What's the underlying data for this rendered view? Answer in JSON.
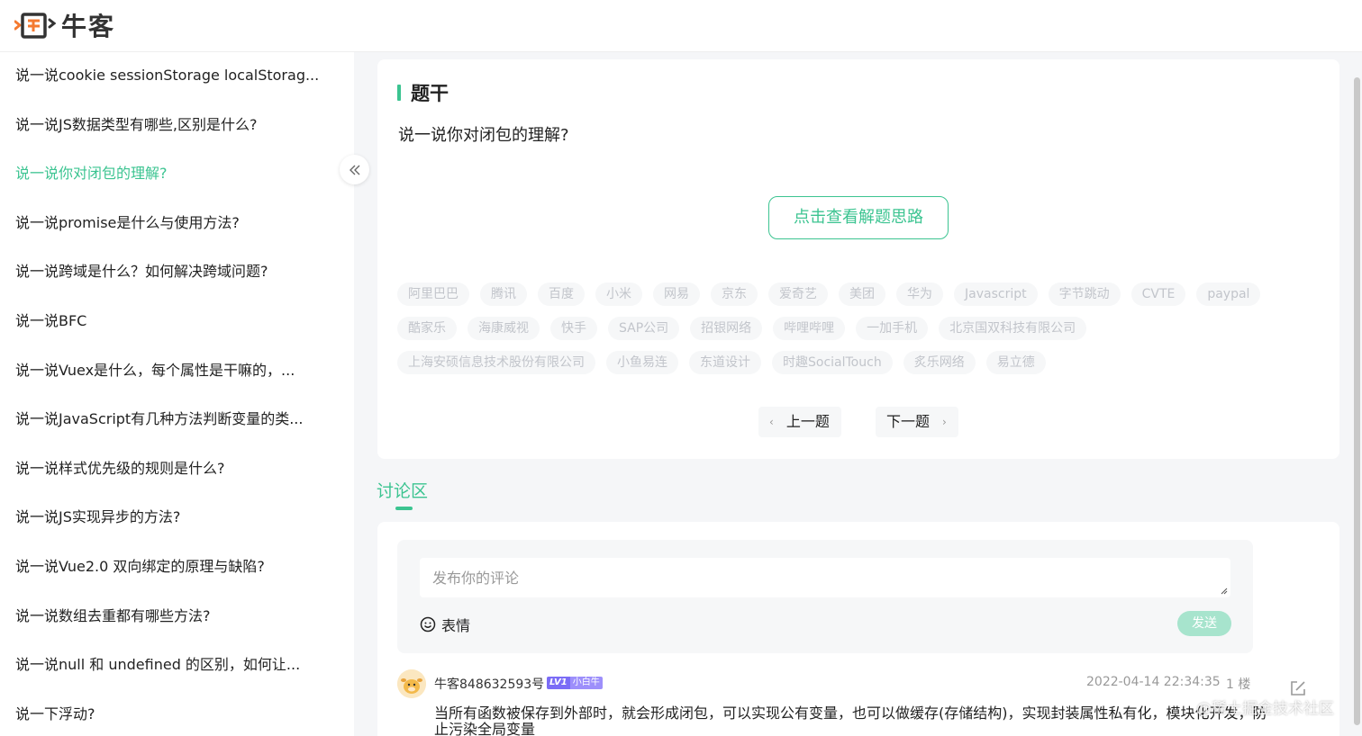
{
  "brand": {
    "name": "牛客",
    "accent": "#3cc491"
  },
  "sidebar": {
    "items": [
      {
        "label": "说一说cookie sessionStorage localStorag..."
      },
      {
        "label": "说一说JS数据类型有哪些,区别是什么?"
      },
      {
        "label": "说一说你对闭包的理解?",
        "active": true
      },
      {
        "label": "说一说promise是什么与使用方法?"
      },
      {
        "label": "说一说跨域是什么？如何解决跨域问题?"
      },
      {
        "label": "说一说BFC"
      },
      {
        "label": "说一说Vuex是什么，每个属性是干嘛的，..."
      },
      {
        "label": "说一说JavaScript有几种方法判断变量的类..."
      },
      {
        "label": "说一说样式优先级的规则是什么?"
      },
      {
        "label": "说一说JS实现异步的方法?"
      },
      {
        "label": "说一说Vue2.0 双向绑定的原理与缺陷?"
      },
      {
        "label": "说一说数组去重都有哪些方法?"
      },
      {
        "label": "说一说null 和 undefined 的区别，如何让..."
      },
      {
        "label": "说一下浮动?"
      }
    ],
    "collapse_icon": "double-chevron-left-icon"
  },
  "question": {
    "section_title": "题干",
    "text": "说一说你对闭包的理解?",
    "hint_button": "点击查看解题思路",
    "tags": [
      [
        "阿里巴巴",
        "腾讯",
        "百度",
        "小米",
        "网易",
        "京东",
        "爱奇艺",
        "美团",
        "华为",
        "Javascript",
        "字节跳动",
        "CVTE",
        "paypal"
      ],
      [
        "酷家乐",
        "海康威视",
        "快手",
        "SAP公司",
        "招银网络",
        "哔哩哔哩",
        "一加手机",
        "北京国双科技有限公司"
      ],
      [
        "上海安硕信息技术股份有限公司",
        "小鱼易连",
        "东道设计",
        "时趣SocialTouch",
        "炙乐网络",
        "易立德"
      ]
    ],
    "prev_label": "上一题",
    "next_label": "下一题"
  },
  "discussion": {
    "title": "讨论区",
    "input_placeholder": "发布你的评论",
    "emoji_label": "表情",
    "send_label": "发送",
    "comments": [
      {
        "user": "牛客848632593号",
        "level": "LV1",
        "level_name": "小白牛",
        "time": "2022-04-14 22:34:35",
        "floor": "1 楼",
        "body": "当所有函数被保存到外部时，就会形成闭包，可以实现公有变量，也可以做缓存(存储结构)，实现封装属性私有化，模块化开发，防止污染全局变量"
      }
    ]
  },
  "watermark": "@稀土掘金技术社区"
}
